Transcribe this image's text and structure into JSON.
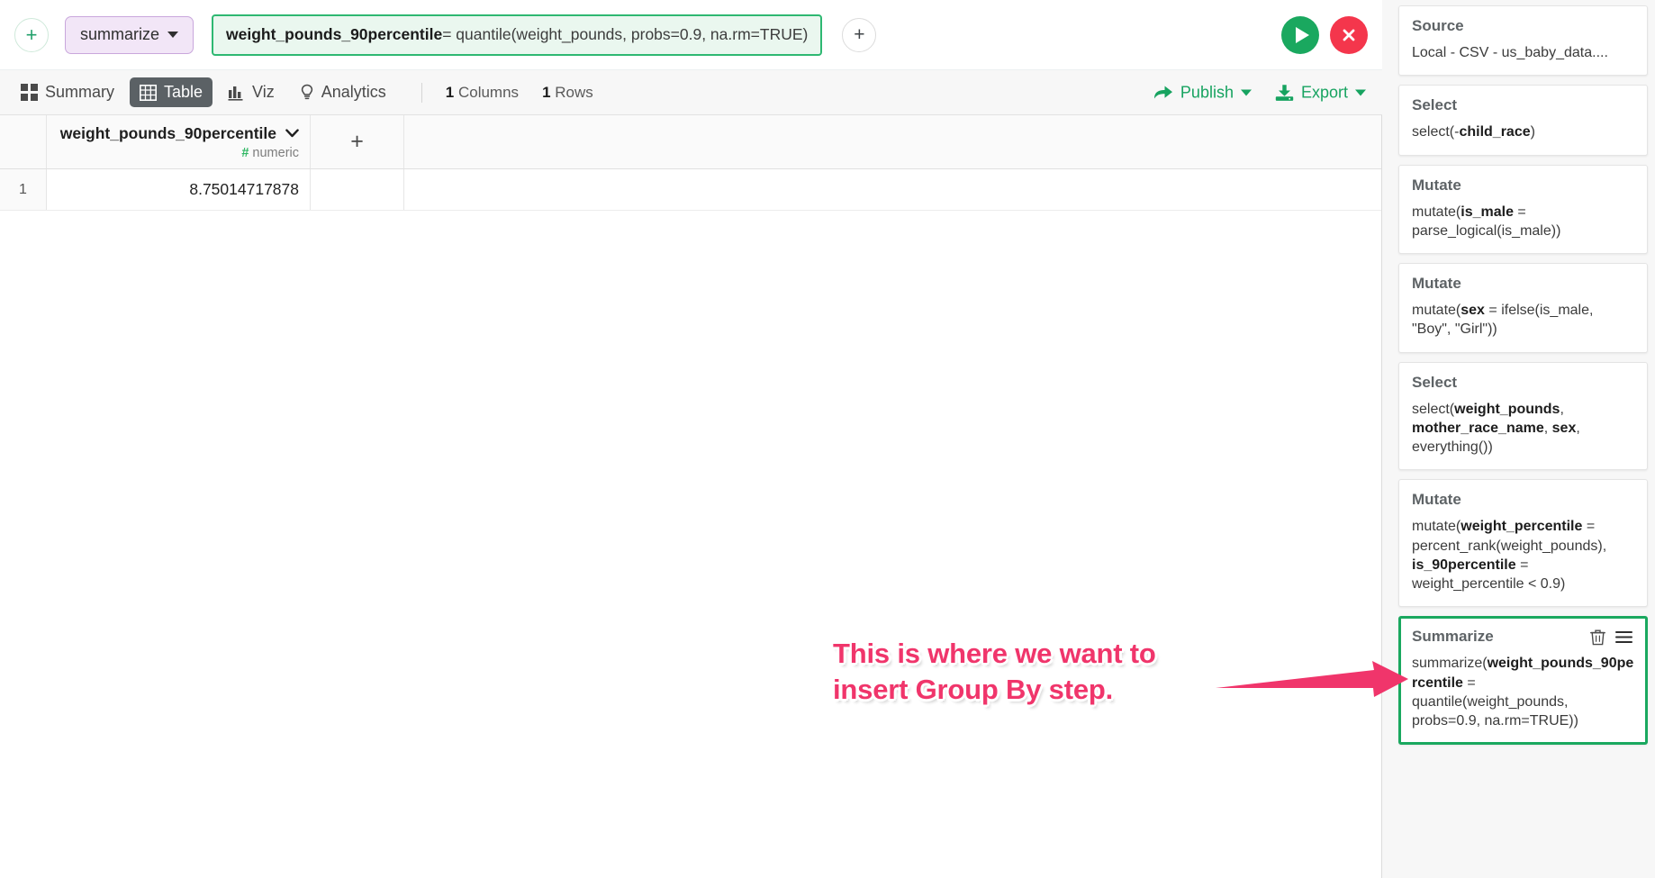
{
  "toolbar": {
    "add_step_before_label": "+",
    "verb_label": "summarize",
    "formula_name": "weight_pounds_90percentile",
    "formula_rest": " = quantile(weight_pounds, probs=0.9, na.rm=TRUE)",
    "add_step_after_label": "+",
    "run_label": "run",
    "cancel_label": "cancel"
  },
  "tabs": [
    {
      "label": "Summary",
      "icon": "grid-squares-icon",
      "active": false
    },
    {
      "label": "Table",
      "icon": "table-icon",
      "active": true
    },
    {
      "label": "Viz",
      "icon": "bar-chart-icon",
      "active": false
    },
    {
      "label": "Analytics",
      "icon": "lightbulb-icon",
      "active": false
    }
  ],
  "meta": {
    "columns_count": "1",
    "columns_label": "Columns",
    "rows_count": "1",
    "rows_label": "Rows"
  },
  "actions": {
    "publish_label": "Publish",
    "export_label": "Export"
  },
  "table": {
    "column_name": "weight_pounds_90percentile",
    "column_type": "numeric",
    "type_prefix": "#",
    "add_column_label": "+",
    "rows": [
      {
        "index": "1",
        "value": "8.75014717878"
      }
    ]
  },
  "pipeline": {
    "steps": [
      {
        "title": "Source",
        "body_html": "Local - CSV - us_baby_data....",
        "highlighted": false
      },
      {
        "title": "Select",
        "body_html": "select(-<b>child_race</b>)",
        "highlighted": false
      },
      {
        "title": "Mutate",
        "body_html": "mutate(<b>is_male</b> = parse_logical(is_male))",
        "highlighted": false
      },
      {
        "title": "Mutate",
        "body_html": "mutate(<b>sex</b> = ifelse(is_male, \"Boy\", \"Girl\"))",
        "highlighted": false
      },
      {
        "title": "Select",
        "body_html": "select(<b>weight_pounds</b>, <b>mother_race_name</b>, <b>sex</b>, everything())",
        "highlighted": false
      },
      {
        "title": "Mutate",
        "body_html": "mutate(<b>weight_percentile</b> = percent_rank(weight_pounds), <b>is_90percentile</b> = weight_percentile &lt; 0.9)",
        "highlighted": false
      },
      {
        "title": "Summarize",
        "body_html": "summarize(<b>weight_pounds_90percentile</b> = quantile(weight_pounds, probs=0.9, na.rm=TRUE))",
        "highlighted": true,
        "delete_label": "delete",
        "menu_label": "menu"
      }
    ]
  },
  "annotation": {
    "text": "This is where we want to insert Group By step.",
    "color": "#f0356b",
    "arrow_color": "#f0356b"
  },
  "colors": {
    "accent_green": "#1aa85f",
    "cancel_red": "#f4364c",
    "verb_purple": "#f2e6f7",
    "annotation_pink": "#f0356b"
  }
}
